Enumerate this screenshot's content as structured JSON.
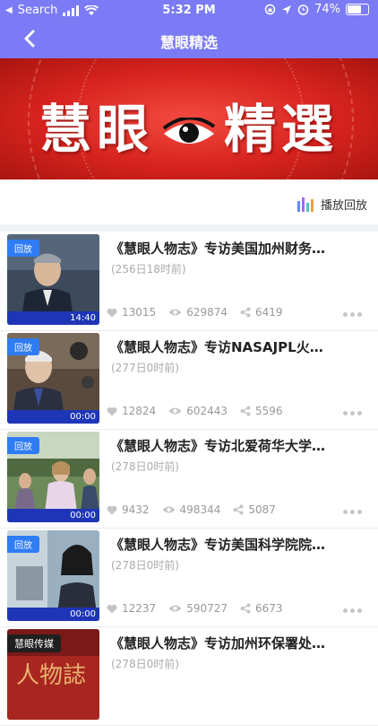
{
  "status_bar": {
    "carrier": "Search",
    "time": "5:32 PM",
    "battery": "74%",
    "battery_level": 0.74
  },
  "header": {
    "title": "慧眼精选"
  },
  "banner": {
    "title_left": "慧眼",
    "title_right": "精選"
  },
  "playback": {
    "label": "播放回放"
  },
  "items": [
    {
      "badge": "回放",
      "title": "《慧眼人物志》专访美国加州财务…",
      "time": "(256日18时前)",
      "duration": "14:40",
      "likes": "13015",
      "views": "629874",
      "shares": "6419"
    },
    {
      "badge": "回放",
      "title": "《慧眼人物志》专访NASAJPL火…",
      "time": "(277日0时前)",
      "duration": "00:00",
      "likes": "12824",
      "views": "602443",
      "shares": "5596"
    },
    {
      "badge": "回放",
      "title": "《慧眼人物志》专访北爱荷华大学…",
      "time": "(278日0时前)",
      "duration": "00:00",
      "likes": "9432",
      "views": "498344",
      "shares": "5087"
    },
    {
      "badge": "回放",
      "title": "《慧眼人物志》专访美国科学院院…",
      "time": "(278日0时前)",
      "duration": "00:00",
      "likes": "12237",
      "views": "590727",
      "shares": "6673"
    },
    {
      "badge": "慧眼传媒",
      "title": "《慧眼人物志》专访加州环保署处…",
      "time": "(278日0时前)"
    }
  ]
}
